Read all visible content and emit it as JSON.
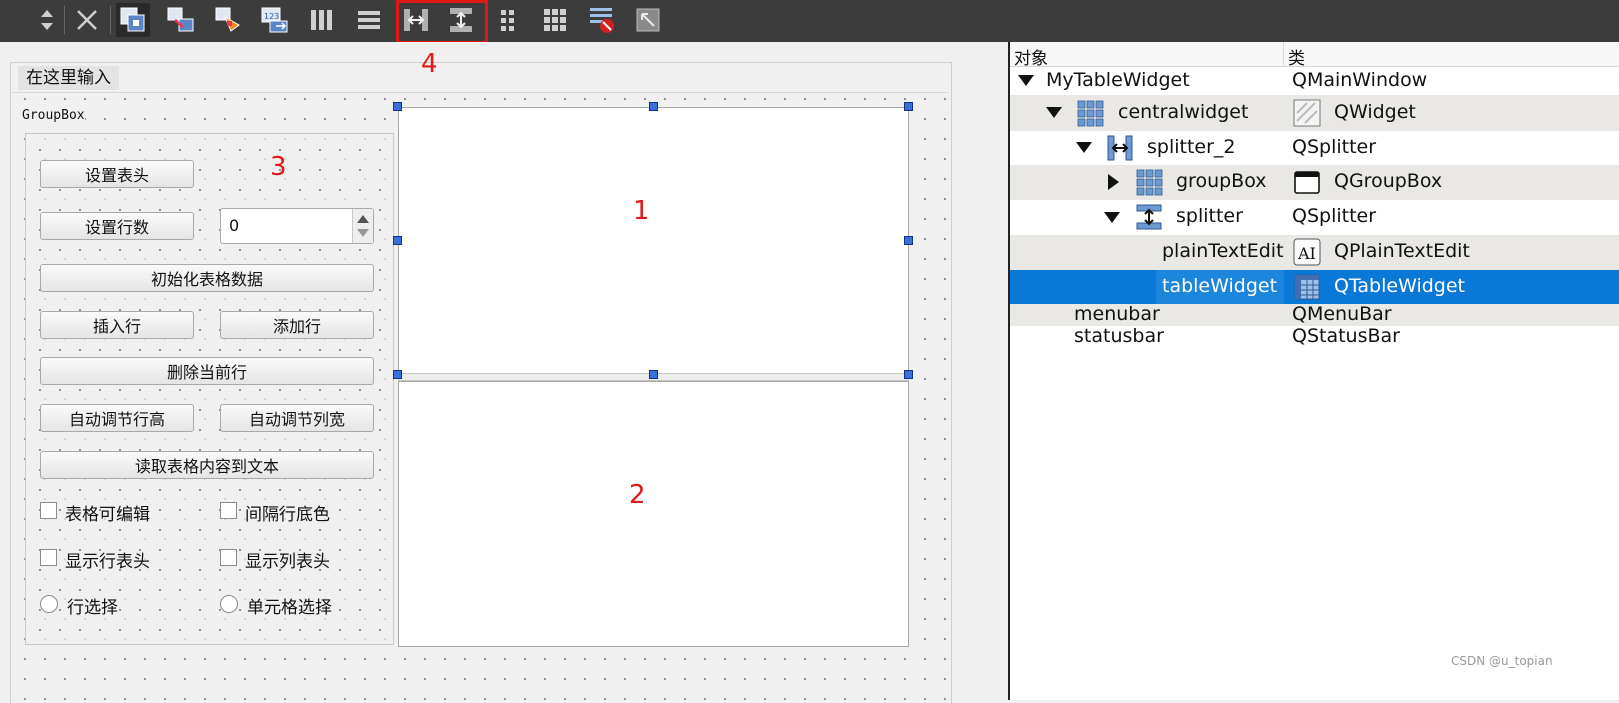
{
  "toolbar": {
    "icons": [
      "move-updown-icon",
      "close-icon",
      "edit-widgets-icon",
      "edit-signals-slots-icon",
      "edit-buddies-icon",
      "edit-tab-order-icon",
      "layout-horizontal-icon",
      "layout-vertical-icon",
      "splitter-horizontal-icon",
      "splitter-vertical-icon",
      "layout-form-icon",
      "layout-grid-icon",
      "break-layout-icon",
      "adjust-size-icon"
    ],
    "highlight_color": "#e01818"
  },
  "form": {
    "menu_placeholder": "在这里输入",
    "groupbox_title": "GroupBox",
    "buttons": {
      "set_header": "设置表头",
      "set_rows": "设置行数",
      "init_table": "初始化表格数据",
      "insert_row": "插入行",
      "add_row": "添加行",
      "delete_row": "删除当前行",
      "auto_row_height": "自动调节行高",
      "auto_col_width": "自动调节列宽",
      "read_to_text": "读取表格内容到文本"
    },
    "row_count_value": "0",
    "checkboxes": {
      "editable": "表格可编辑",
      "alternate_color": "间隔行底色",
      "show_row_header": "显示行表头",
      "show_col_header": "显示列表头"
    },
    "radios": {
      "row_select": "行选择",
      "cell_select": "单元格选择"
    }
  },
  "annotations": {
    "one": "1",
    "two": "2",
    "three": "3",
    "four": "4",
    "color": "#e01818"
  },
  "inspector": {
    "col_object": "对象",
    "col_class": "类",
    "rows": [
      {
        "name": "MyTableWidget",
        "class": "QMainWindow"
      },
      {
        "name": "centralwidget",
        "class": "QWidget"
      },
      {
        "name": "splitter_2",
        "class": "QSplitter"
      },
      {
        "name": "groupBox",
        "class": "QGroupBox"
      },
      {
        "name": "splitter",
        "class": "QSplitter"
      },
      {
        "name": "plainTextEdit",
        "class": "QPlainTextEdit"
      },
      {
        "name": "tableWidget",
        "class": "QTableWidget"
      },
      {
        "name": "menubar",
        "class": "QMenuBar"
      },
      {
        "name": "statusbar",
        "class": "QStatusBar"
      }
    ],
    "selected_color": "#0a78d7"
  },
  "watermark": "CSDN @u_topian"
}
